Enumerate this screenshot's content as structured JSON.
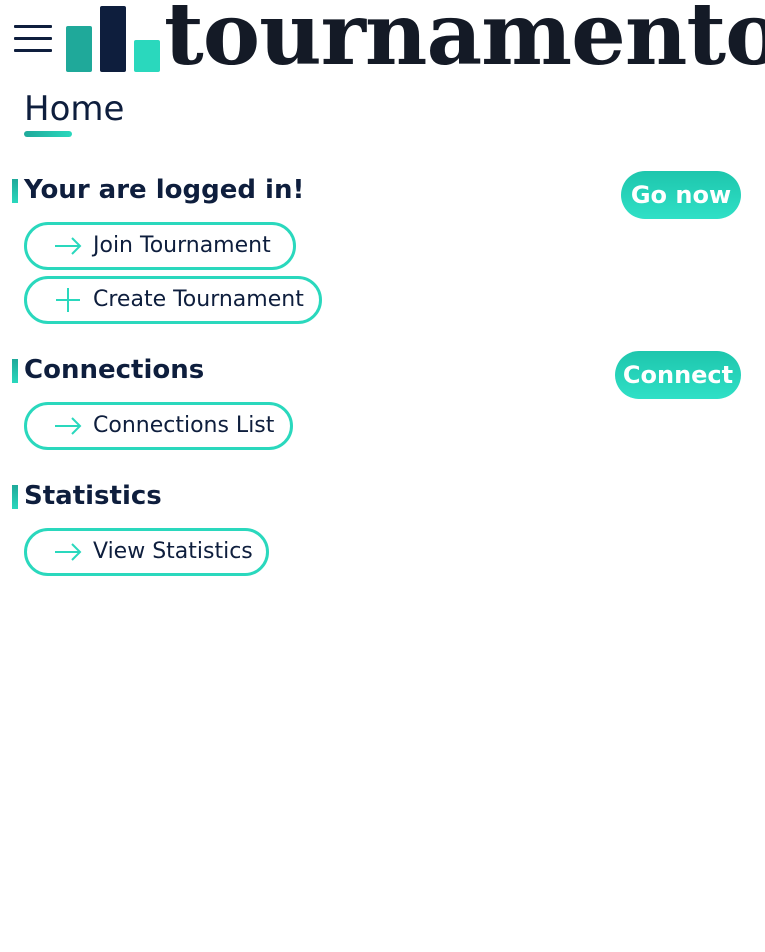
{
  "header": {
    "menu_icon": "hamburger-menu-icon",
    "logo_text": "tournamento",
    "logo_colors": {
      "bar_1": "#1fa99a",
      "bar_2": "#0e1e3d",
      "bar_3": "#2ad8bd"
    }
  },
  "page": {
    "title": "Home"
  },
  "sections": [
    {
      "title": "Your are logged in!",
      "action_label": "Go now",
      "buttons": [
        {
          "label": "Join Tournament",
          "icon": "arrow-right-icon"
        },
        {
          "label": "Create Tournament",
          "icon": "plus-icon"
        }
      ]
    },
    {
      "title": "Connections",
      "action_label": "Connect",
      "buttons": [
        {
          "label": "Connections List",
          "icon": "arrow-right-icon"
        }
      ]
    },
    {
      "title": "Statistics",
      "buttons": [
        {
          "label": "View Statistics",
          "icon": "arrow-right-icon"
        }
      ]
    }
  ],
  "colors": {
    "accent": "#2ad8bd",
    "accent_dark": "#1fa99a",
    "text": "#0e1e3d",
    "background": "#ffffff"
  }
}
